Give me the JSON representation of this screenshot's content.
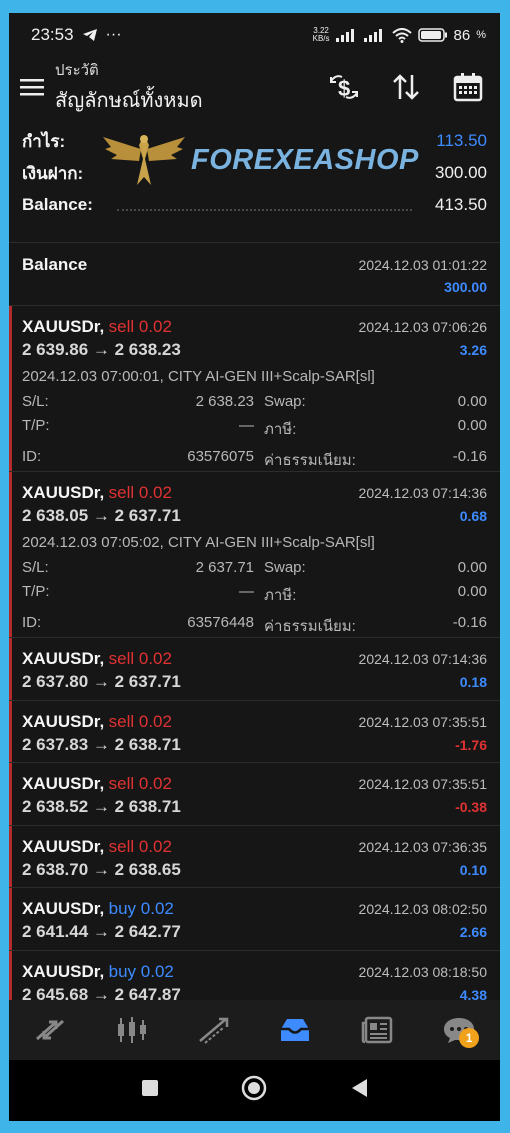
{
  "status": {
    "time": "23:53",
    "net_speed_value": "3.22",
    "net_speed_unit": "KB/s",
    "battery": "86"
  },
  "appbar": {
    "subtitle": "ประวัติ",
    "title": "สัญลักษณ์ทั้งหมด"
  },
  "summary": {
    "profit_label": "กำไร:",
    "profit_value": "113.50",
    "deposit_label": "เงินฝาก:",
    "deposit_value": "300.00",
    "balance_label": "Balance:",
    "balance_value": "413.50",
    "watermark": "FOREXEASHOP"
  },
  "balance_row": {
    "label": "Balance",
    "time": "2024.12.03 01:01:22",
    "amount": "300.00"
  },
  "labels": {
    "sl": "S/L:",
    "tp": "T/P:",
    "id": "ID:",
    "swap": "Swap:",
    "tax": "ภาษี:",
    "commission": "ค่าธรรมเนียม:"
  },
  "trades": [
    {
      "symbol": "XAUUSDr,",
      "side": "sell 0.02",
      "type": "sell",
      "time": "2024.12.03 07:06:26",
      "prices": "2 639.86 → 2 638.23",
      "pnl": "3.26",
      "pnl_sign": "pos",
      "comment": "2024.12.03 07:00:01, CITY AI-GEN III+Scalp-SAR[sl]",
      "sl": "2 638.23",
      "tp": "—",
      "id": "63576075",
      "swap": "0.00",
      "tax": "0.00",
      "commission": "-0.16"
    },
    {
      "symbol": "XAUUSDr,",
      "side": "sell 0.02",
      "type": "sell",
      "time": "2024.12.03 07:14:36",
      "prices": "2 638.05 → 2 637.71",
      "pnl": "0.68",
      "pnl_sign": "pos",
      "comment": "2024.12.03 07:05:02, CITY AI-GEN III+Scalp-SAR[sl]",
      "sl": "2 637.71",
      "tp": "—",
      "id": "63576448",
      "swap": "0.00",
      "tax": "0.00",
      "commission": "-0.16"
    },
    {
      "symbol": "XAUUSDr,",
      "side": "sell 0.02",
      "type": "sell",
      "time": "2024.12.03 07:14:36",
      "prices": "2 637.80 → 2 637.71",
      "pnl": "0.18",
      "pnl_sign": "pos"
    },
    {
      "symbol": "XAUUSDr,",
      "side": "sell 0.02",
      "type": "sell",
      "time": "2024.12.03 07:35:51",
      "prices": "2 637.83 → 2 638.71",
      "pnl": "-1.76",
      "pnl_sign": "neg"
    },
    {
      "symbol": "XAUUSDr,",
      "side": "sell 0.02",
      "type": "sell",
      "time": "2024.12.03 07:35:51",
      "prices": "2 638.52 → 2 638.71",
      "pnl": "-0.38",
      "pnl_sign": "neg"
    },
    {
      "symbol": "XAUUSDr,",
      "side": "sell 0.02",
      "type": "sell",
      "time": "2024.12.03 07:36:35",
      "prices": "2 638.70 → 2 638.65",
      "pnl": "0.10",
      "pnl_sign": "pos"
    },
    {
      "symbol": "XAUUSDr,",
      "side": "buy 0.02",
      "type": "buy",
      "time": "2024.12.03 08:02:50",
      "prices": "2 641.44 → 2 642.77",
      "pnl": "2.66",
      "pnl_sign": "pos"
    },
    {
      "symbol": "XAUUSDr,",
      "side": "buy 0.02",
      "type": "buy",
      "time": "2024.12.03 08:18:50",
      "prices": "2 645.68 → 2 647.87",
      "pnl": "4.38",
      "pnl_sign": "pos"
    }
  ],
  "tabs": [
    {
      "name": "quotes-icon"
    },
    {
      "name": "chart-icon"
    },
    {
      "name": "trade-icon"
    },
    {
      "name": "history-icon",
      "active": true
    },
    {
      "name": "news-icon"
    },
    {
      "name": "messages-icon",
      "badge": "1"
    }
  ],
  "colors": {
    "accent": "#3d8bff",
    "loss": "#e03232",
    "background": "#161616",
    "frame": "#3fb4e8"
  }
}
